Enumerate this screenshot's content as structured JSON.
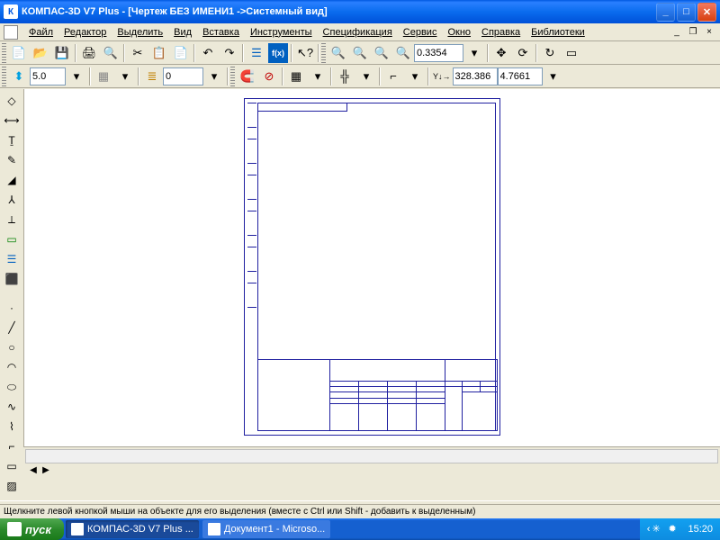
{
  "titlebar": {
    "text": "КОМПАС-3D V7 Plus - [Чертеж БЕЗ ИМЕНИ1 ->Системный вид]"
  },
  "menu": {
    "items": [
      "Файл",
      "Редактор",
      "Выделить",
      "Вид",
      "Вставка",
      "Инструменты",
      "Спецификация",
      "Сервис",
      "Окно",
      "Справка",
      "Библиотеки"
    ]
  },
  "toolbar1": {
    "zoom_value": "0.3354"
  },
  "toolbar2": {
    "line_weight": "5.0",
    "layer_value": "0",
    "coord_x": "328.386",
    "coord_y": "4.7661"
  },
  "statusbar": {
    "text": "Щелкните левой кнопкой мыши на объекте для его выделения (вместе с Ctrl или Shift - добавить к выделенным)"
  },
  "taskbar": {
    "start": "пуск",
    "items": [
      {
        "label": "КОМПАС-3D V7 Plus ...",
        "active": true
      },
      {
        "label": "Документ1 - Microso...",
        "active": false
      }
    ],
    "clock": "15:20"
  }
}
